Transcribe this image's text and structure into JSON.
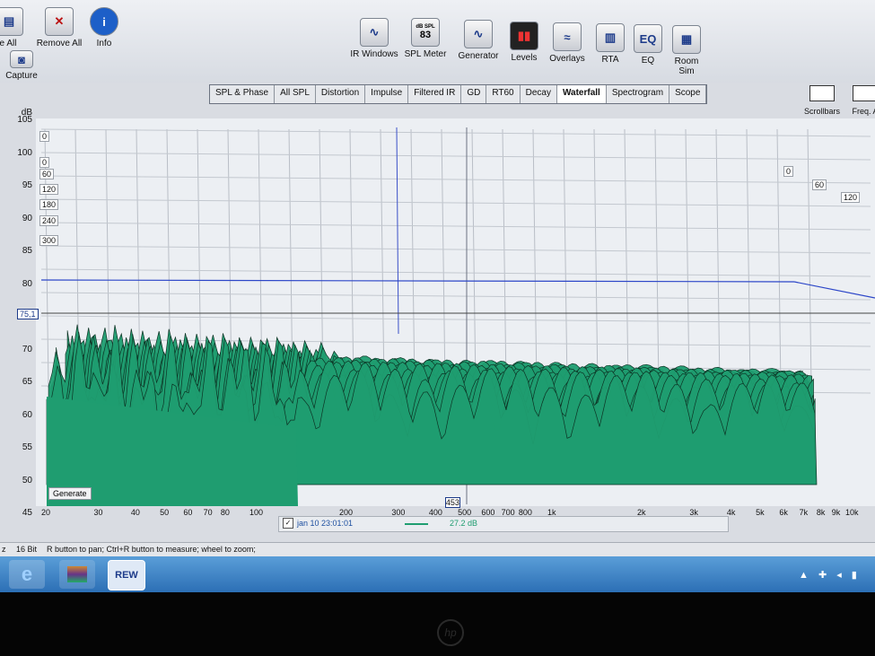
{
  "toolbar": {
    "left_buttons": [
      "e All",
      "Remove All",
      "Info"
    ],
    "capture_label": "Capture",
    "main_buttons": [
      {
        "label": "IR Windows",
        "icon": "ir-windows-icon"
      },
      {
        "label": "SPL Meter",
        "icon": "spl-meter-icon",
        "badge_top": "dB SPL",
        "badge_value": "83"
      },
      {
        "label": "Generator",
        "icon": "generator-icon"
      },
      {
        "label": "Levels",
        "icon": "levels-icon"
      },
      {
        "label": "Overlays",
        "icon": "overlays-icon"
      },
      {
        "label": "RTA",
        "icon": "rta-icon"
      },
      {
        "label": "EQ",
        "icon": "eq-icon"
      },
      {
        "label": "Room Sim",
        "icon": "room-sim-icon"
      }
    ],
    "right_buttons": [
      "Scrollbars",
      "Freq. A"
    ]
  },
  "tabs": [
    "SPL & Phase",
    "All SPL",
    "Distortion",
    "Impulse",
    "Filtered IR",
    "GD",
    "RT60",
    "Decay",
    "Waterfall",
    "Spectrogram",
    "Scope"
  ],
  "active_tab": "Waterfall",
  "plot": {
    "y_unit": "dB",
    "y_ticks": [
      "105",
      "100",
      "95",
      "90",
      "85",
      "80",
      "75",
      "70",
      "65",
      "60",
      "55",
      "50",
      "45"
    ],
    "cursor_value": "75,1",
    "x_ticks": [
      "20",
      "30",
      "40",
      "50",
      "60",
      "70",
      "80",
      "100",
      "200",
      "300",
      "400",
      "453",
      "500",
      "600",
      "700",
      "800",
      "1k",
      "2k",
      "3k",
      "4k",
      "5k",
      "6k",
      "7k",
      "8k",
      "9k",
      "10k"
    ],
    "z_labels_left": [
      "0",
      "0",
      "60",
      "120",
      "180",
      "240",
      "300"
    ],
    "z_labels_right": [
      "0",
      "60",
      "120"
    ],
    "generate_label": "Generate",
    "fill_color": "#1f9d70",
    "line_color": "#0d3324",
    "h_line_color": "#2c46c8"
  },
  "legend": {
    "checked": true,
    "name": "jan 10 23:01:01",
    "value": "27.2 dB"
  },
  "status": {
    "rate": "z",
    "bits": "16 Bit",
    "hint": "R button to pan; Ctrl+R button to measure; wheel to zoom;"
  },
  "taskbar": {
    "apps": [
      "ie-icon",
      "winrar-icon",
      "rew-icon"
    ],
    "rew_label": "REW"
  },
  "bezel_logo": "hp"
}
